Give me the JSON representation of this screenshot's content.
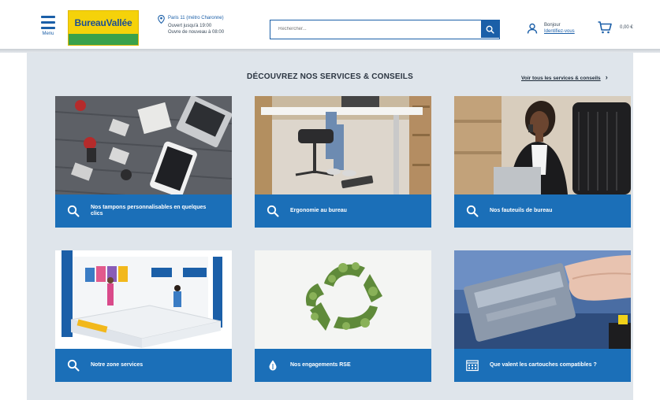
{
  "header": {
    "menu_label": "Menu",
    "logo_text": "BureauVallée",
    "store": {
      "name": "Paris 11 (métro Charonne)",
      "open_line": "Ouvert jusqu'à 19:00",
      "reopen_line": "Ouvre de nouveau à 08:00"
    },
    "search": {
      "placeholder": "Rechercher..."
    },
    "account": {
      "greeting": "Bonjour",
      "link": "Identifiez-vous"
    },
    "cart": {
      "total": "0,00 €"
    }
  },
  "section": {
    "title": "DÉCOUVREZ NOS SERVICES & CONSEILS",
    "see_all": "Voir tous les services & conseils"
  },
  "cards": [
    {
      "label": "Nos tampons personnalisables en quelques clics",
      "icon": "search-icon"
    },
    {
      "label": "Ergonomie au bureau",
      "icon": "search-icon"
    },
    {
      "label": "Nos fauteuils de bureau",
      "icon": "search-icon"
    },
    {
      "label": "Notre zone services",
      "icon": "search-icon"
    },
    {
      "label": "Nos engagements RSE",
      "icon": "leaf-drop-icon"
    },
    {
      "label": "Que valent les cartouches compatibles ?",
      "icon": "calendar-grid-icon"
    }
  ],
  "colors": {
    "brand_blue": "#1b5fa8",
    "card_bar_blue": "#1b6fb8",
    "logo_yellow": "#f5d20a",
    "logo_green": "#3aa14b",
    "section_bg": "#dfe5eb"
  }
}
